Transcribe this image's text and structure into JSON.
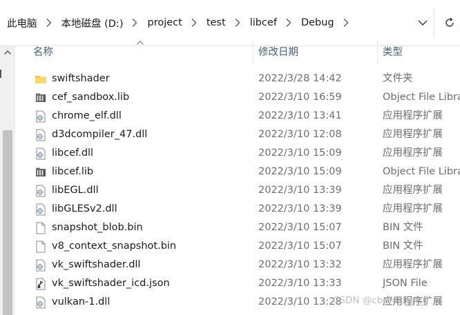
{
  "breadcrumb": [
    "此电脑",
    "本地磁盘 (D:)",
    "project",
    "test",
    "libcef",
    "Debug"
  ],
  "columns": {
    "name": "名称",
    "date": "修改日期",
    "type": "类型"
  },
  "files": [
    {
      "name": "swiftshader",
      "date": "2022/3/28 14:42",
      "type": "文件夹",
      "icon": "folder-icon"
    },
    {
      "name": "cef_sandbox.lib",
      "date": "2022/3/10 16:59",
      "type": "Object File Libra",
      "icon": "library-file-icon"
    },
    {
      "name": "chrome_elf.dll",
      "date": "2022/3/10 13:41",
      "type": "应用程序扩展",
      "icon": "dll-file-icon"
    },
    {
      "name": "d3dcompiler_47.dll",
      "date": "2022/3/10 12:08",
      "type": "应用程序扩展",
      "icon": "dll-file-icon"
    },
    {
      "name": "libcef.dll",
      "date": "2022/3/10 15:09",
      "type": "应用程序扩展",
      "icon": "dll-file-icon"
    },
    {
      "name": "libcef.lib",
      "date": "2022/3/10 15:09",
      "type": "Object File Libra",
      "icon": "library-file-icon"
    },
    {
      "name": "libEGL.dll",
      "date": "2022/3/10 13:39",
      "type": "应用程序扩展",
      "icon": "dll-file-icon"
    },
    {
      "name": "libGLESv2.dll",
      "date": "2022/3/10 13:39",
      "type": "应用程序扩展",
      "icon": "dll-file-icon"
    },
    {
      "name": "snapshot_blob.bin",
      "date": "2022/3/10 15:07",
      "type": "BIN 文件",
      "icon": "blank-file-icon"
    },
    {
      "name": "v8_context_snapshot.bin",
      "date": "2022/3/10 15:07",
      "type": "BIN 文件",
      "icon": "blank-file-icon"
    },
    {
      "name": "vk_swiftshader.dll",
      "date": "2022/3/10 13:32",
      "type": "应用程序扩展",
      "icon": "dll-file-icon"
    },
    {
      "name": "vk_swiftshader_icd.json",
      "date": "2022/3/10 13:33",
      "type": "JSON File",
      "icon": "json-file-icon"
    },
    {
      "name": "vulkan-1.dll",
      "date": "2022/3/10 13:28",
      "type": "应用程序扩展",
      "icon": "dll-file-icon"
    }
  ],
  "watermark": "CSDN @cbdfdshgf_6"
}
